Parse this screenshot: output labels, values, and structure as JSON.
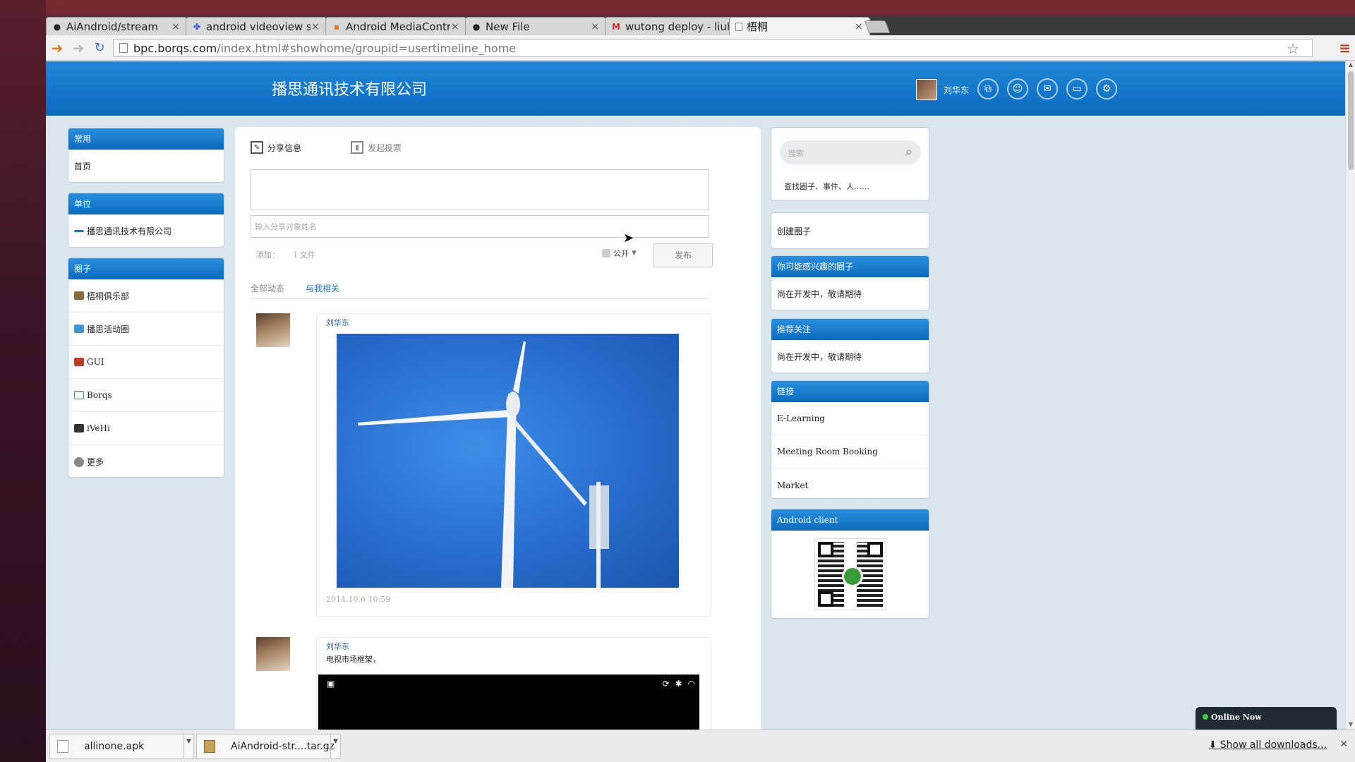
{
  "browser": {
    "tabs": [
      {
        "title": "AiAndroid/stream",
        "icon": "github-icon",
        "active": false
      },
      {
        "title": "android videoview sta",
        "icon": "paw-icon",
        "active": false
      },
      {
        "title": "Android MediaContro",
        "icon": "page-icon",
        "active": false
      },
      {
        "title": "New File",
        "icon": "github-icon",
        "active": false
      },
      {
        "title": "wutong deploy - liuhu",
        "icon": "gmail-icon",
        "active": false
      },
      {
        "title": "梧桐",
        "icon": "page-icon",
        "active": true
      }
    ],
    "url_host": "bpc.borqs.com",
    "url_path": "/index.html#showhome/groupid=usertimeline_home"
  },
  "header": {
    "company": "播思通讯技术有限公司",
    "user_name": "刘华东",
    "icons": [
      "circles-icon",
      "profile-icon",
      "mail-icon",
      "chat-icon",
      "settings-icon"
    ]
  },
  "left": {
    "common": {
      "title": "常用",
      "items": [
        "首页"
      ]
    },
    "unit": {
      "title": "单位",
      "items": [
        "播思通讯技术有限公司"
      ]
    },
    "circles": {
      "title": "圈子",
      "items": [
        "梧桐俱乐部",
        "播思活动圈",
        "GUI",
        "Borqs",
        "iVeHi"
      ],
      "more": "更多"
    }
  },
  "composer": {
    "tab_share": "分享信息",
    "tab_vote": "发起投票",
    "share_placeholder": "输入分享对象姓名",
    "add_label": "添加：",
    "file_label": "文件",
    "visibility": "公开",
    "publish": "发布"
  },
  "feed_tabs": {
    "all": "全部动态",
    "related": "与我相关"
  },
  "posts": [
    {
      "author": "刘华东",
      "text": "",
      "date": "2014.10.6 10:59"
    },
    {
      "author": "刘华东",
      "text": "电视市场框架，",
      "date": ""
    }
  ],
  "right": {
    "search_placeholder": "搜索",
    "search_hint": "查找圈子、事件、人……",
    "create_circle": "创建圈子",
    "interesting": {
      "title": "你可能感兴趣的圈子",
      "text": "尚在开发中，敬请期待"
    },
    "recommend": {
      "title": "推荐关注",
      "text": "尚在开发中，敬请期待"
    },
    "links": {
      "title": "链接",
      "items": [
        "E-Learning",
        "Meeting Room Booking",
        "Market"
      ]
    },
    "android": {
      "title": "Android client"
    }
  },
  "online": "Online Now",
  "downloads": {
    "items": [
      "allinone.apk",
      "AiAndroid-str....tar.gz"
    ],
    "show_all": "Show all downloads..."
  }
}
